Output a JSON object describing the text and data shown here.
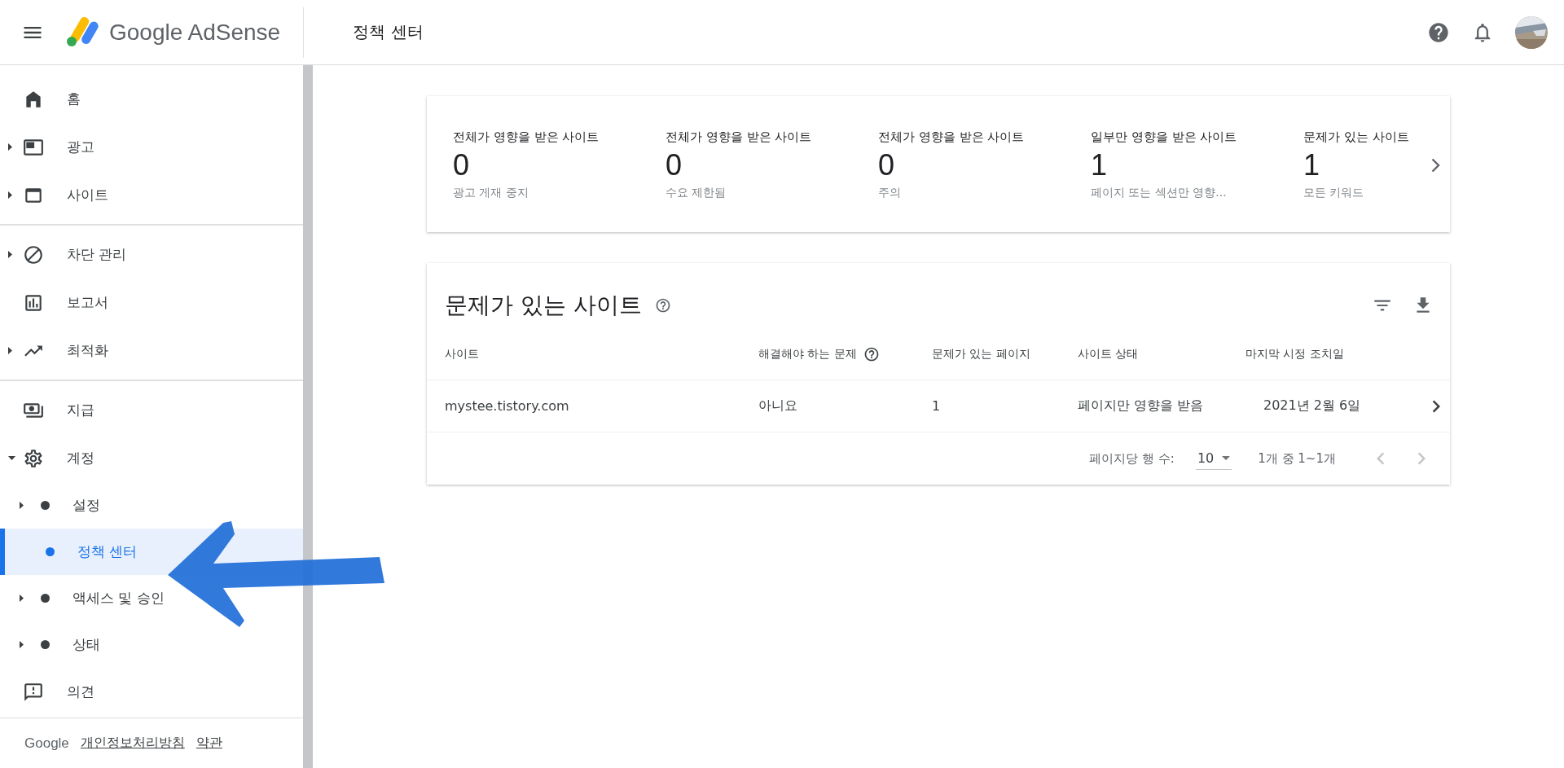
{
  "header": {
    "logo_text": "Google AdSense",
    "page_title": "정책 센터"
  },
  "sidebar": {
    "groups": [
      {
        "items": [
          {
            "label": "홈",
            "expandable": false,
            "selected": false
          },
          {
            "label": "광고",
            "expandable": true,
            "selected": false
          },
          {
            "label": "사이트",
            "expandable": true,
            "selected": false
          }
        ]
      },
      {
        "items": [
          {
            "label": "차단 관리",
            "expandable": true,
            "selected": false
          },
          {
            "label": "보고서",
            "expandable": false,
            "selected": false
          },
          {
            "label": "최적화",
            "expandable": true,
            "selected": false
          }
        ]
      },
      {
        "items": [
          {
            "label": "지급",
            "expandable": false,
            "selected": false
          },
          {
            "label": "계정",
            "expandable": true,
            "expanded": true,
            "selected": false,
            "children": [
              {
                "label": "설정",
                "expandable": true,
                "selected": false
              },
              {
                "label": "정책 센터",
                "expandable": false,
                "selected": true
              },
              {
                "label": "액세스 및 승인",
                "expandable": true,
                "selected": false
              },
              {
                "label": "상태",
                "expandable": true,
                "selected": false
              }
            ]
          },
          {
            "label": "의견",
            "expandable": false,
            "selected": false
          }
        ]
      }
    ],
    "footer": {
      "brand": "Google",
      "links": [
        "개인정보처리방침",
        "약관"
      ]
    }
  },
  "summary": [
    {
      "title": "전체가 영향을 받은 사이트",
      "value": "0",
      "caption": "광고 게재 중지"
    },
    {
      "title": "전체가 영향을 받은 사이트",
      "value": "0",
      "caption": "수요 제한됨"
    },
    {
      "title": "전체가 영향을 받은 사이트",
      "value": "0",
      "caption": "주의"
    },
    {
      "title": "일부만 영향을 받은 사이트",
      "value": "1",
      "caption": "페이지 또는 섹션만 영향..."
    },
    {
      "title": "문제가 있는 사이트",
      "value": "1",
      "caption": "모든 키워드"
    }
  ],
  "table": {
    "title": "문제가 있는 사이트",
    "columns": [
      {
        "label": "사이트",
        "help": false
      },
      {
        "label": "해결해야 하는 문제",
        "help": true
      },
      {
        "label": "문제가 있는 페이지",
        "help": false
      },
      {
        "label": "사이트 상태",
        "help": false
      },
      {
        "label": "마지막 시정 조치일",
        "help": false
      }
    ],
    "rows": [
      [
        "mystee.tistory.com",
        "아니요",
        "1",
        "페이지만 영향을 받음",
        "2021년 2월 6일"
      ]
    ],
    "pagination": {
      "rows_per_page_label": "페이지당 행 수:",
      "rows_per_page": "10",
      "range": "1개 중 1~1개"
    }
  }
}
